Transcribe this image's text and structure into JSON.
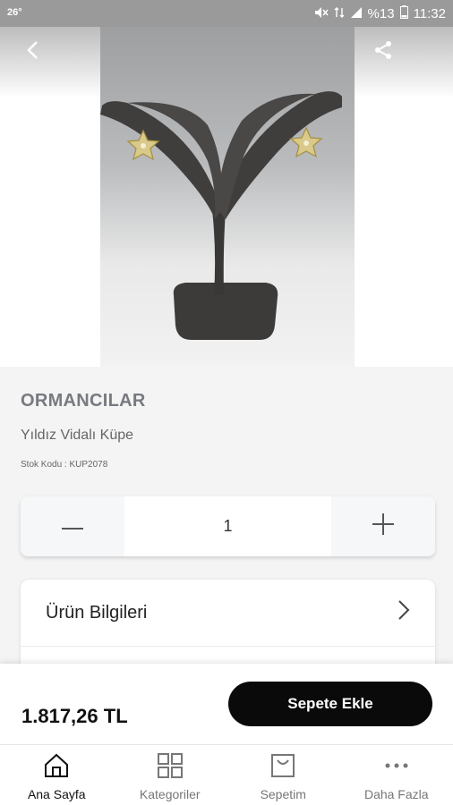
{
  "status_bar": {
    "temperature": "26°",
    "battery": "%13",
    "time": "11:32"
  },
  "product": {
    "brand": "ORMANCILAR",
    "name": "Yıldız Vidalı Küpe",
    "stock_code": "Stok Kodu : KUP2078",
    "quantity": "1",
    "price": "1.817,26 TL"
  },
  "info": {
    "product_info_label": "Ürün Bilgileri"
  },
  "actions": {
    "add_to_cart": "Sepete Ekle"
  },
  "nav": {
    "home": "Ana Sayfa",
    "categories": "Kategoriler",
    "cart": "Sepetim",
    "more": "Daha Fazla"
  },
  "colors": {
    "accent": "#0a0a0a",
    "brand_text": "#777a80"
  }
}
